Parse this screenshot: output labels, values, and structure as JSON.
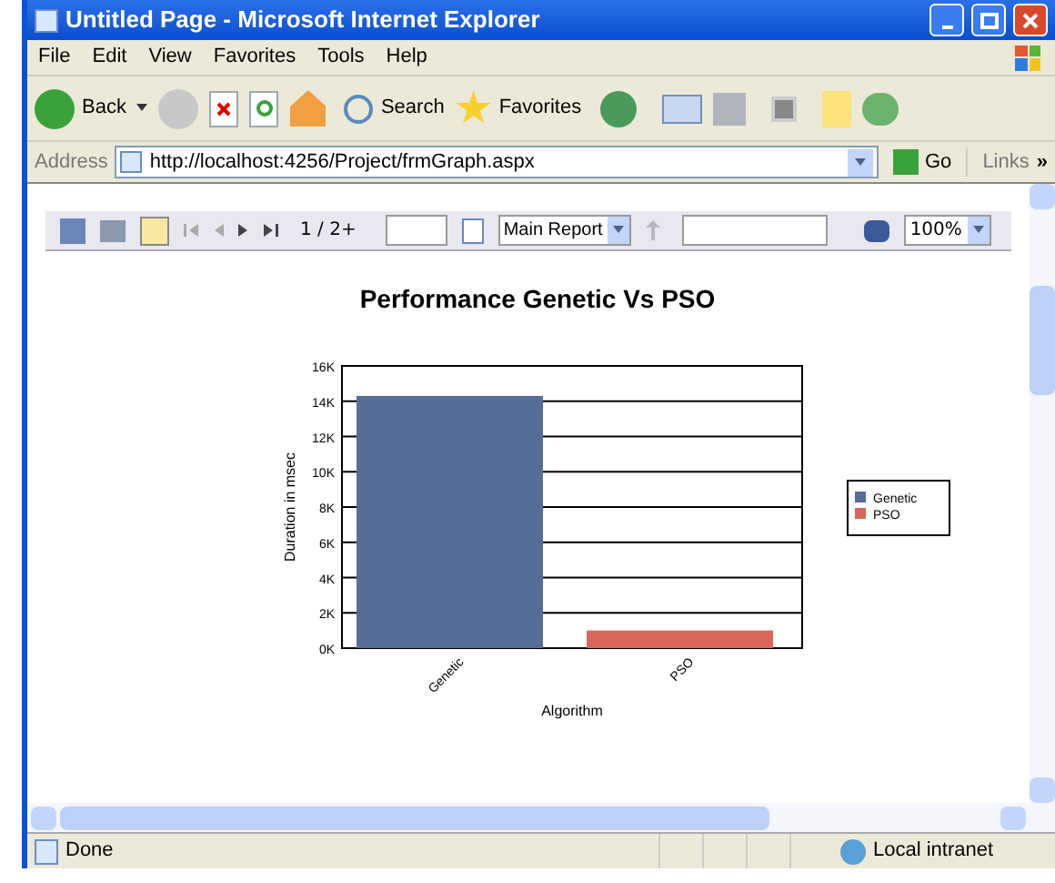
{
  "window": {
    "title": "Untitled Page - Microsoft Internet Explorer"
  },
  "menu": [
    "File",
    "Edit",
    "View",
    "Favorites",
    "Tools",
    "Help"
  ],
  "toolbar": {
    "back": "Back",
    "search": "Search",
    "favorites": "Favorites"
  },
  "address": {
    "label": "Address",
    "url": "http://localhost:4256/Project/frmGraph.aspx",
    "go": "Go",
    "links": "Links",
    "more": "»"
  },
  "report_toolbar": {
    "page": "1 / 2+",
    "group": "Main Report",
    "zoom": "100%"
  },
  "chart": {
    "chart_data": {
      "type": "bar",
      "title": "Performance Genetic Vs PSO",
      "xlabel": "Algorithm",
      "ylabel": "Duration in msec",
      "categories": [
        "Genetic",
        "PSO"
      ],
      "series": [
        {
          "name": "Genetic",
          "color": "#566d98",
          "values": [
            14300,
            null
          ]
        },
        {
          "name": "PSO",
          "color": "#d9675c",
          "values": [
            null,
            1000
          ]
        }
      ],
      "ylim": [
        0,
        16000
      ],
      "grid": true,
      "legend": true,
      "yticks": [
        {
          "value": 0,
          "label": "0K"
        },
        {
          "value": 2000,
          "label": "2K"
        },
        {
          "value": 4000,
          "label": "4K"
        },
        {
          "value": 6000,
          "label": "6K"
        },
        {
          "value": 8000,
          "label": "8K"
        },
        {
          "value": 10000,
          "label": "10K"
        },
        {
          "value": 12000,
          "label": "12K"
        },
        {
          "value": 14000,
          "label": "14K"
        },
        {
          "value": 16000,
          "label": "16K"
        }
      ]
    }
  },
  "status_bar": {
    "text": "Done",
    "zone": "Local intranet"
  }
}
